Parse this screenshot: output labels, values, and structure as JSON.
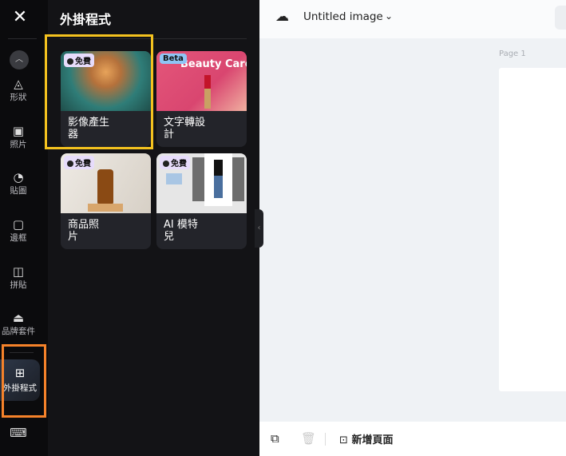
{
  "rail": {
    "items": [
      {
        "label": "形狀",
        "icon": "shapes-icon"
      },
      {
        "label": "照片",
        "icon": "photo-icon"
      },
      {
        "label": "貼圖",
        "icon": "sticker-icon"
      },
      {
        "label": "邊框",
        "icon": "frame-icon"
      },
      {
        "label": "拼貼",
        "icon": "collage-icon"
      },
      {
        "label": "品牌套件",
        "icon": "brand-kit-icon"
      }
    ],
    "active": {
      "label": "外掛程式",
      "icon": "plugins-icon"
    }
  },
  "panel": {
    "title": "外掛程式",
    "cards": [
      {
        "label": "影像產生器",
        "badge": "免費"
      },
      {
        "label": "文字轉設計",
        "badge": "Beta",
        "image_text": "Beauty Care"
      },
      {
        "label": "商品照片",
        "badge": "免費"
      },
      {
        "label": "AI 模特兒",
        "badge": "免費"
      }
    ]
  },
  "header": {
    "title": "Untitled image"
  },
  "canvas": {
    "page_label": "Page 1"
  },
  "bottom": {
    "add_page": "新增頁面"
  },
  "colors": {
    "highlight_yellow": "#f4c21f",
    "highlight_orange": "#f5822a"
  }
}
